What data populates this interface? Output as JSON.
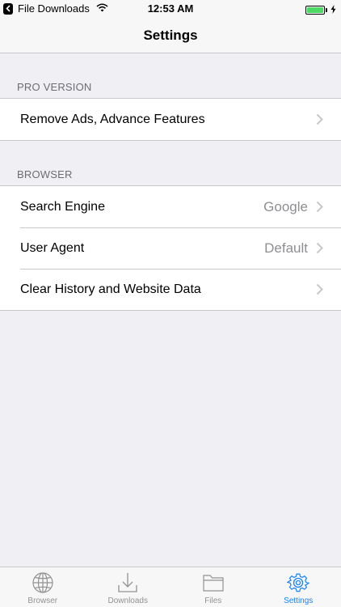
{
  "status_bar": {
    "back_app": "File Downloads",
    "time": "12:53 AM"
  },
  "nav": {
    "title": "Settings"
  },
  "sections": [
    {
      "header": "PRO VERSION",
      "rows": [
        {
          "label": "Remove Ads, Advance Features",
          "value": ""
        }
      ]
    },
    {
      "header": "BROWSER",
      "rows": [
        {
          "label": "Search Engine",
          "value": "Google"
        },
        {
          "label": "User Agent",
          "value": "Default"
        },
        {
          "label": "Clear History and Website Data",
          "value": ""
        }
      ]
    }
  ],
  "tabs": [
    {
      "label": "Browser",
      "icon": "globe-icon"
    },
    {
      "label": "Downloads",
      "icon": "download-icon"
    },
    {
      "label": "Files",
      "icon": "folder-icon"
    },
    {
      "label": "Settings",
      "icon": "gear-icon",
      "active": true
    }
  ],
  "colors": {
    "accent": "#1a82fb",
    "background": "#efeff4",
    "battery": "#4cd964",
    "secondary_text": "#8e8e93"
  }
}
